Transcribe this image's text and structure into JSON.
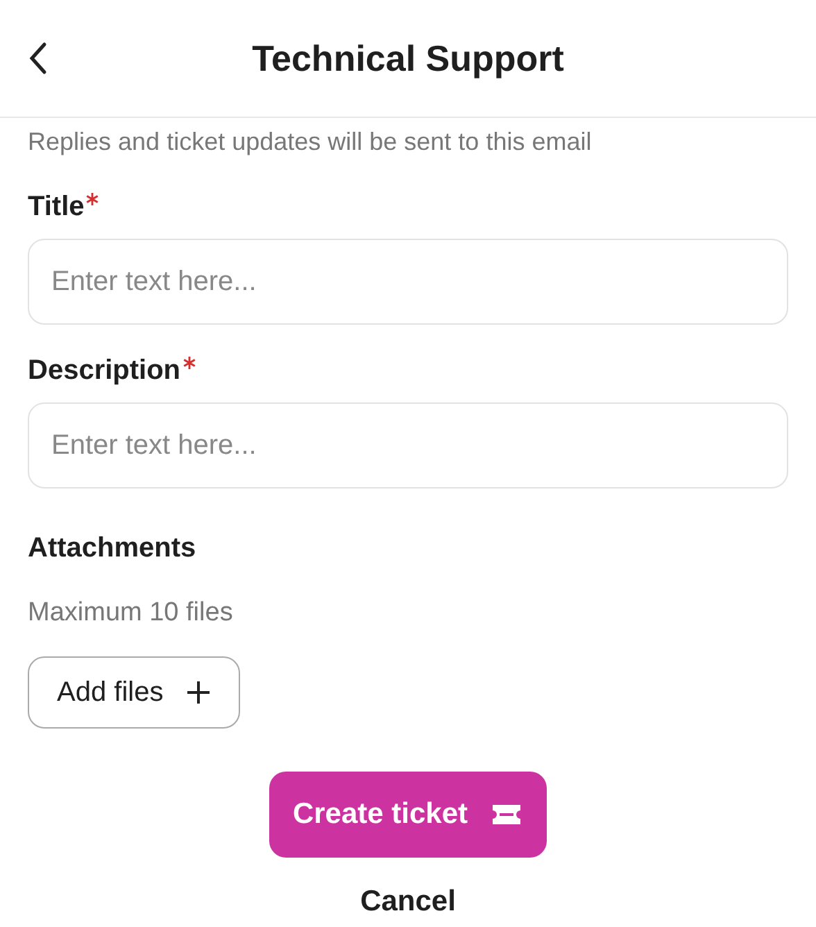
{
  "header": {
    "title": "Technical Support"
  },
  "email_note": "Replies and ticket updates will be sent to this email",
  "fields": [
    {
      "label": "Title",
      "required": true,
      "placeholder": "Enter text here..."
    },
    {
      "label": "Description",
      "required": true,
      "placeholder": "Enter text here..."
    }
  ],
  "attachments": {
    "label": "Attachments",
    "hint": "Maximum 10 files",
    "button": "Add files"
  },
  "submit": "Create ticket",
  "cancel": "Cancel"
}
